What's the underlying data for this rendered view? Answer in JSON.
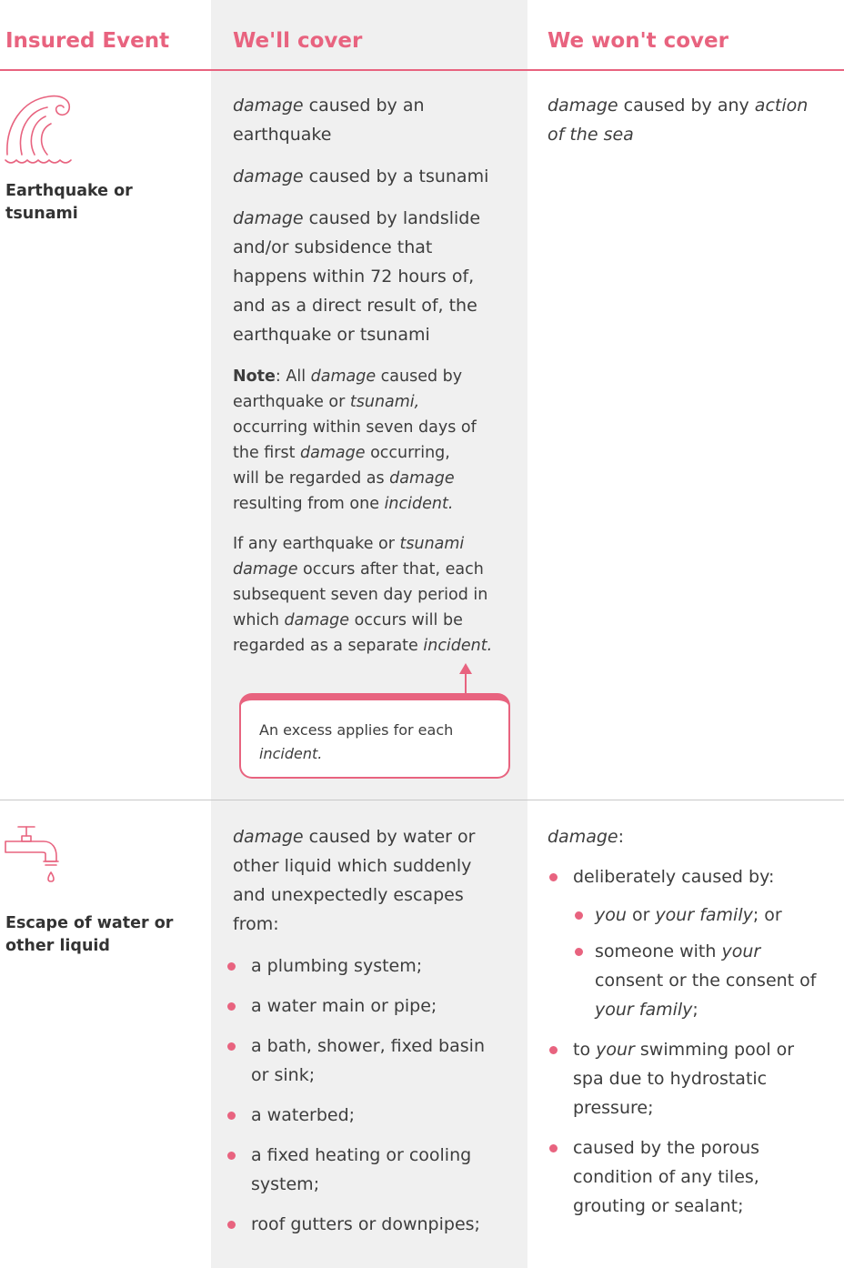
{
  "headers": {
    "event": "Insured Event",
    "cover": "We'll cover",
    "no_cover": "We won't cover"
  },
  "accent_color": "#e8637f",
  "rows": [
    {
      "icon": "wave-icon",
      "event": "Earthquake or tsunami",
      "cover": {
        "p1_a": "damage",
        "p1_b": " caused by an earthquake",
        "p2_a": "damage",
        "p2_b": " caused by a tsunami",
        "p3_a": "damage",
        "p3_b": " caused by landslide and/or subsidence that happens within 72 hours of, and as a direct result of, the earthquake or tsunami",
        "note_label": "Note",
        "note_a": ": All ",
        "note_b": "damage",
        "note_c": " caused by earthquake or ",
        "note_d": "tsunami,",
        "note_e": " occurring within seven days of the first ",
        "note_f": "damage",
        "note_g": " occurring, will be regarded as ",
        "note_h": "damage",
        "note_i": " resulting from one ",
        "note_j": "incident.",
        "if_a": "If any earthquake or ",
        "if_b": "tsunami damage",
        "if_c": " occurs after that, each subsequent seven day period in which ",
        "if_d": "damage",
        "if_e": " occurs will be regarded as a separate ",
        "if_f": "incident.",
        "callout_a": "An excess applies for each ",
        "callout_b": "incident."
      },
      "no_cover": {
        "a": "damage",
        "b": " caused by any ",
        "c": "action of the sea"
      }
    },
    {
      "icon": "tap-icon",
      "event": "Escape of water or other liquid",
      "cover": {
        "intro_a": "damage",
        "intro_b": " caused by water or other liquid which suddenly and unexpectedly escapes from:",
        "items": [
          "a plumbing system;",
          "a water main or pipe;",
          "a bath, shower, fixed basin or sink;",
          "a waterbed;",
          "a fixed heating or cooling system;",
          "roof gutters or downpipes;"
        ]
      },
      "no_cover": {
        "intro": "damage",
        "intro_tail": ":",
        "b1": "deliberately caused by:",
        "s1_a": "you",
        "s1_b": " or ",
        "s1_c": "your family",
        "s1_d": "; or",
        "s2_a": "someone with ",
        "s2_b": "your",
        "s2_c": " consent or the consent of ",
        "s2_d": "your family",
        "s2_e": ";",
        "b2_a": "to ",
        "b2_b": "your",
        "b2_c": " swimming pool or spa due to hydrostatic pressure;",
        "b3": "caused by the porous condition of any tiles, grouting or sealant;"
      }
    }
  ]
}
